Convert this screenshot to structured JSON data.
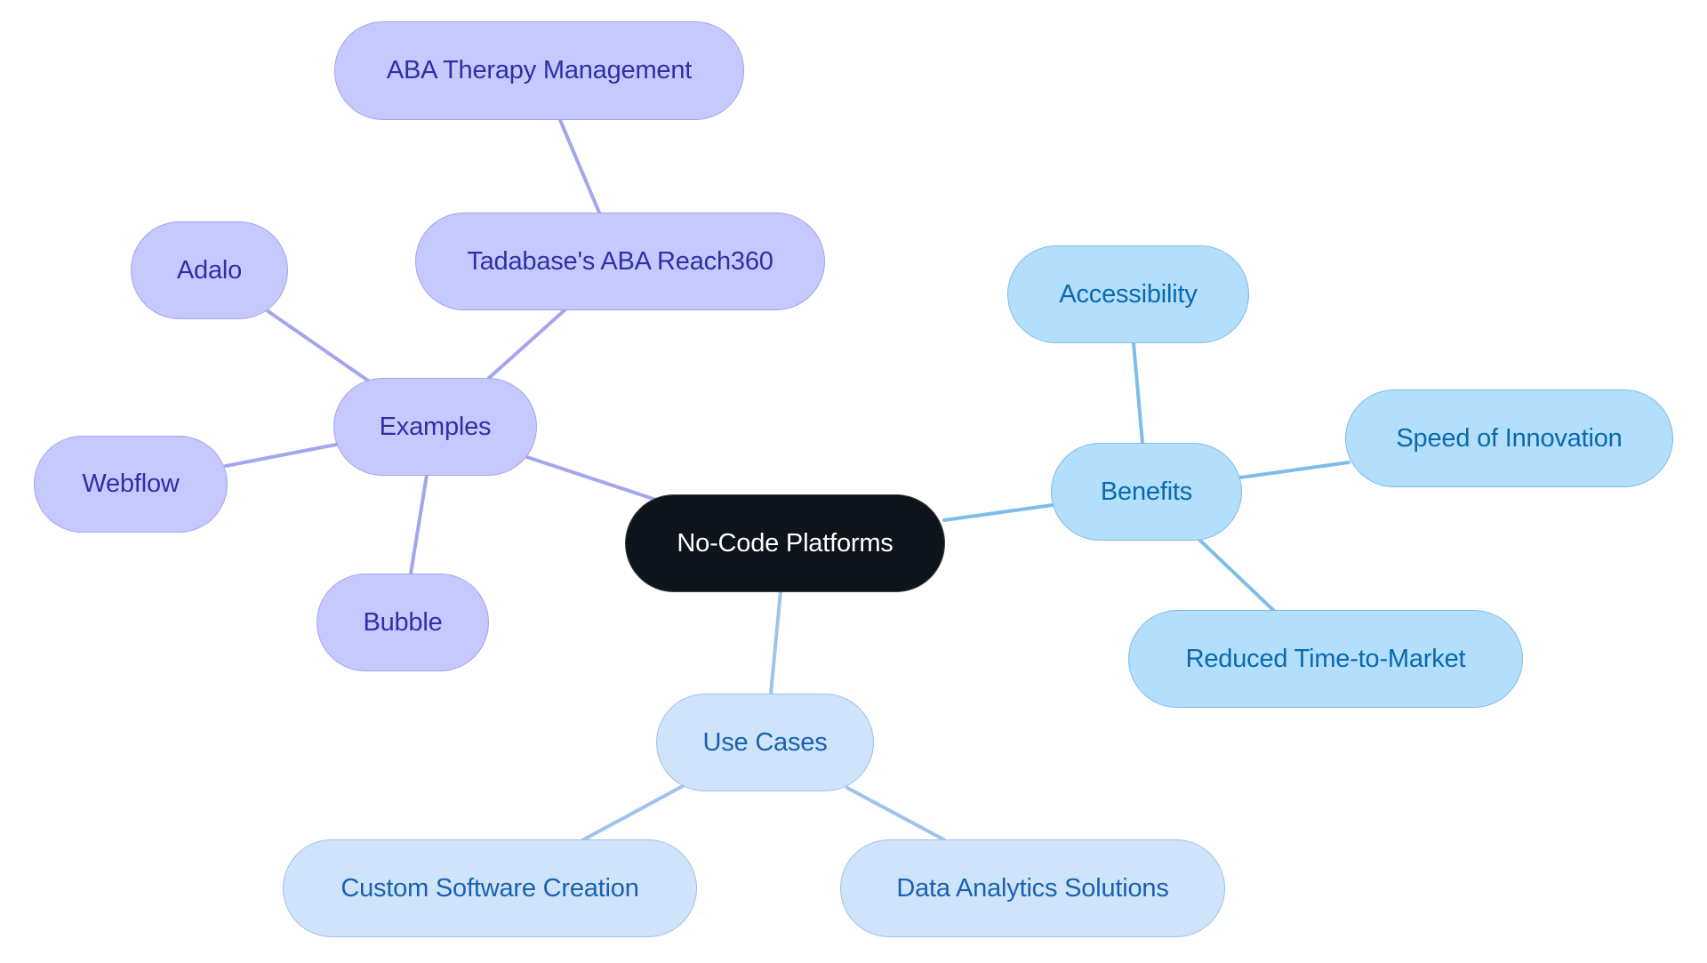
{
  "diagram": {
    "type": "mindmap",
    "colors": {
      "root_fill": "#0d141b",
      "root_text": "#ffffff",
      "examples_fill": "#c6c9fe",
      "examples_line": "#a3a6ec",
      "examples_text": "#2f2fa6",
      "benefits_fill": "#b3defc",
      "benefits_line": "#7fbde9",
      "benefits_text": "#0a6aad",
      "usecases_fill": "#cfe3fb",
      "usecases_line": "#9fc3ec",
      "usecases_text": "#1862b0"
    },
    "root": {
      "label": "No-Code Platforms"
    },
    "examples": {
      "label": "Examples",
      "children": [
        {
          "label": "Tadabase's ABA Reach360",
          "children": [
            {
              "label": "ABA Therapy Management"
            }
          ]
        },
        {
          "label": "Adalo"
        },
        {
          "label": "Webflow"
        },
        {
          "label": "Bubble"
        }
      ]
    },
    "benefits": {
      "label": "Benefits",
      "children": [
        {
          "label": "Accessibility"
        },
        {
          "label": "Speed of Innovation"
        },
        {
          "label": "Reduced Time-to-Market"
        }
      ]
    },
    "use_cases": {
      "label": "Use Cases",
      "children": [
        {
          "label": "Custom Software Creation"
        },
        {
          "label": "Data Analytics Solutions"
        }
      ]
    }
  }
}
